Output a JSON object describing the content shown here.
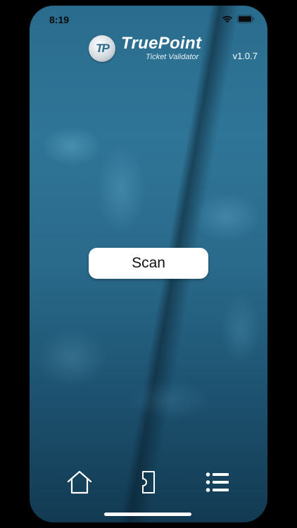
{
  "status_bar": {
    "time": "8:19",
    "wifi_icon": "wifi-icon",
    "battery_icon": "battery-icon"
  },
  "header": {
    "logo_initials": "TP",
    "brand_name": "TruePoint",
    "brand_subtitle": "Ticket Validator",
    "version": "v1.0.7"
  },
  "main": {
    "scan_label": "Scan"
  },
  "tab_bar": {
    "items": [
      {
        "icon": "home-icon"
      },
      {
        "icon": "ticket-icon"
      },
      {
        "icon": "list-icon"
      }
    ]
  },
  "colors": {
    "background_top": "#2f7597",
    "background_bottom": "#123a52",
    "accent": "#2b6b8c",
    "button_bg": "#ffffff"
  }
}
